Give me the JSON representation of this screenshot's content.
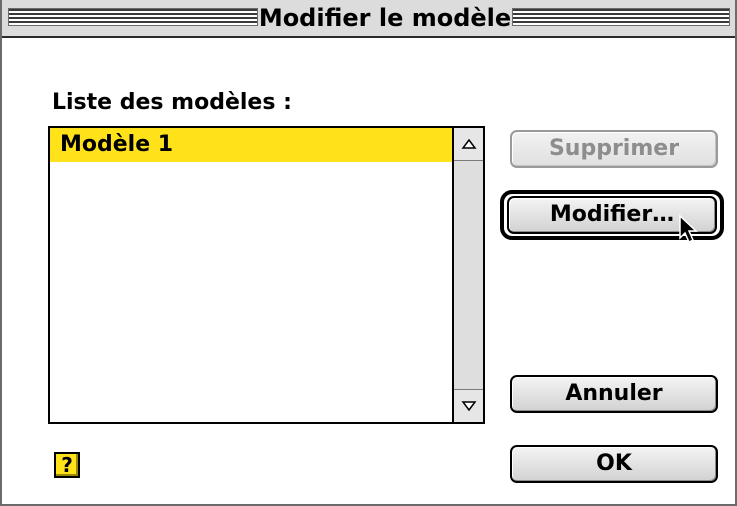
{
  "window": {
    "title": "Modifier le modèle"
  },
  "list": {
    "label": "Liste des modèles :",
    "items": [
      {
        "label": "Modèle 1",
        "selected": true
      }
    ],
    "selected_color": "#ffe21a"
  },
  "buttons": {
    "delete_label": "Supprimer",
    "delete_enabled": false,
    "modify_label": "Modifier…",
    "modify_default": true,
    "cancel_label": "Annuler",
    "ok_label": "OK"
  },
  "help": {
    "icon": "help-question-icon",
    "glyph": "?"
  },
  "icons": {
    "scroll_up": "scroll-up-arrow-icon",
    "scroll_down": "scroll-down-arrow-icon",
    "cursor": "arrow-cursor-icon"
  }
}
